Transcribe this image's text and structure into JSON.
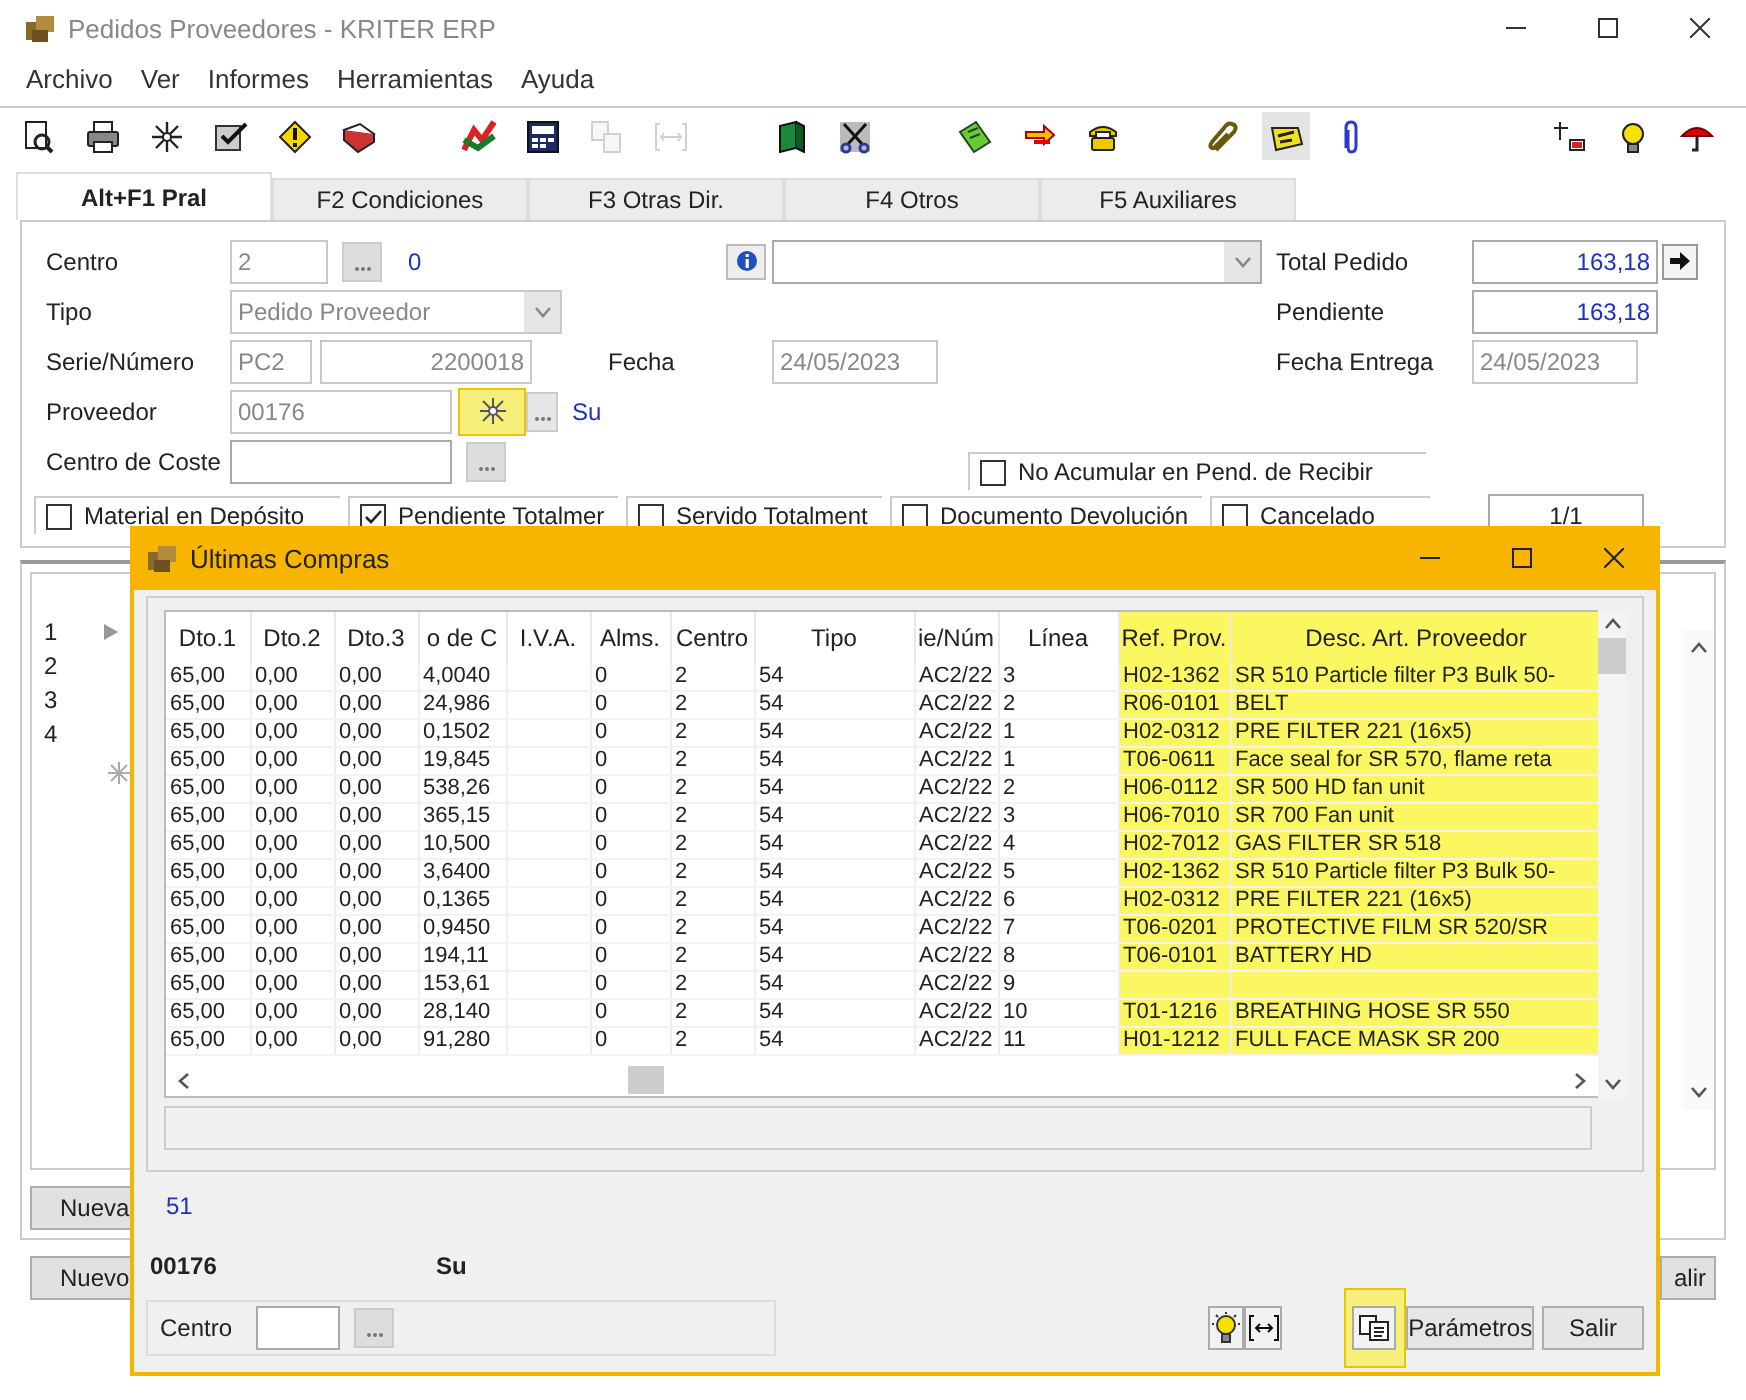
{
  "window": {
    "title": "Pedidos Proveedores - KRITER ERP"
  },
  "menu": [
    "Archivo",
    "Ver",
    "Informes",
    "Herramientas",
    "Ayuda"
  ],
  "toolbar": [
    {
      "items": [
        {
          "disabled": false,
          "pressed": false
        },
        {
          "disabled": false,
          "pressed": false
        },
        {
          "disabled": false,
          "pressed": false
        },
        {
          "disabled": false,
          "pressed": false
        },
        {
          "disabled": false,
          "pressed": false
        },
        {
          "disabled": false,
          "pressed": false
        }
      ]
    },
    {
      "items": [
        {
          "disabled": false,
          "pressed": false
        },
        {
          "disabled": false,
          "pressed": false
        },
        {
          "disabled": true,
          "pressed": false
        },
        {
          "disabled": true,
          "pressed": false
        }
      ]
    },
    {
      "items": [
        {
          "disabled": false,
          "pressed": false
        },
        {
          "disabled": false,
          "pressed": false
        }
      ]
    },
    {
      "items": [
        {
          "disabled": false,
          "pressed": false
        },
        {
          "disabled": false,
          "pressed": false
        },
        {
          "disabled": false,
          "pressed": false
        }
      ]
    },
    {
      "items": [
        {
          "disabled": false,
          "pressed": false
        },
        {
          "disabled": false,
          "pressed": true
        },
        {
          "disabled": false,
          "pressed": false
        }
      ]
    },
    {
      "items": [
        {
          "disabled": false,
          "pressed": false
        },
        {
          "disabled": false,
          "pressed": false
        },
        {
          "disabled": false,
          "pressed": false
        }
      ]
    }
  ],
  "tabs": [
    {
      "label": "Alt+F1 Pral",
      "selected": true
    },
    {
      "label": "F2 Condiciones",
      "selected": false
    },
    {
      "label": "F3 Otras Dir.",
      "selected": false
    },
    {
      "label": "F4 Otros",
      "selected": false
    },
    {
      "label": "F5 Auxiliares",
      "selected": false
    }
  ],
  "form": {
    "centro": {
      "label": "Centro",
      "value": "2",
      "note": "0",
      "disabled": true
    },
    "tipo": {
      "label": "Tipo",
      "value": "Pedido Proveedor",
      "disabled": true
    },
    "serie": {
      "label": "Serie/Número",
      "serie": "PC2",
      "numero": "2200018",
      "disabled": true
    },
    "fecha": {
      "label": "Fecha",
      "value": "24/05/2023",
      "disabled": true
    },
    "proveedor": {
      "label": "Proveedor",
      "value": "00176",
      "name": "Su",
      "disabled": true,
      "search_highlighted": true
    },
    "centro_coste": {
      "label": "Centro de Coste"
    },
    "total_pedido": {
      "label": "Total Pedido",
      "value": "163,18"
    },
    "pendiente": {
      "label": "Pendiente",
      "value": "163,18"
    },
    "fecha_entrega": {
      "label": "Fecha Entrega",
      "value": "24/05/2023",
      "disabled": true
    },
    "no_acumular": {
      "label": "No Acumular en Pend. de Recibir",
      "checked": false
    },
    "flags": [
      {
        "label": "Material en Depósito",
        "checked": false
      },
      {
        "label": "Pendiente Totalmer",
        "checked": true
      },
      {
        "label": "Servido Totalment",
        "checked": false
      },
      {
        "label": "Documento Devolución",
        "checked": false
      },
      {
        "label": "Cancelado",
        "checked": false
      }
    ],
    "page": "1/1"
  },
  "lines": {
    "row_numbers": [
      "1",
      "2",
      "3",
      "4"
    ],
    "new_line_button": "Nueva"
  },
  "bottom_buttons": [
    "Nuevo",
    "alir"
  ],
  "dialog": {
    "title": "Últimas Compras",
    "columns": [
      {
        "label": "Dto.1",
        "highlighted": false
      },
      {
        "label": "Dto.2",
        "highlighted": false
      },
      {
        "label": "Dto.3",
        "highlighted": false
      },
      {
        "label": "o de C",
        "highlighted": false
      },
      {
        "label": "I.V.A.",
        "highlighted": false
      },
      {
        "label": "Alms.",
        "highlighted": false
      },
      {
        "label": "Centro",
        "highlighted": false
      },
      {
        "label": "Tipo",
        "highlighted": false
      },
      {
        "label": "ie/Núm",
        "highlighted": false
      },
      {
        "label": "Línea",
        "highlighted": false
      },
      {
        "label": "Ref. Prov.",
        "highlighted": true
      },
      {
        "label": "Desc. Art. Proveedor",
        "highlighted": true
      }
    ],
    "rows": [
      [
        "65,00",
        "0,00",
        "0,00",
        "4,0040",
        "",
        "0",
        "2",
        "54",
        "AC2/22",
        "3",
        "H02-1362",
        "SR 510 Particle filter P3 Bulk 50-"
      ],
      [
        "65,00",
        "0,00",
        "0,00",
        "24,986",
        "",
        "0",
        "2",
        "54",
        "AC2/22",
        "2",
        "R06-0101",
        "BELT"
      ],
      [
        "65,00",
        "0,00",
        "0,00",
        "0,1502",
        "",
        "0",
        "2",
        "54",
        "AC2/22",
        "1",
        "H02-0312",
        "PRE FILTER 221 (16x5)"
      ],
      [
        "65,00",
        "0,00",
        "0,00",
        "19,845",
        "",
        "0",
        "2",
        "54",
        "AC2/22",
        "1",
        "T06-0611",
        "Face seal for SR 570, flame reta"
      ],
      [
        "65,00",
        "0,00",
        "0,00",
        "538,26",
        "",
        "0",
        "2",
        "54",
        "AC2/22",
        "2",
        "H06-0112",
        "SR 500 HD fan unit"
      ],
      [
        "65,00",
        "0,00",
        "0,00",
        "365,15",
        "",
        "0",
        "2",
        "54",
        "AC2/22",
        "3",
        "H06-7010",
        "SR 700 Fan unit"
      ],
      [
        "65,00",
        "0,00",
        "0,00",
        "10,500",
        "",
        "0",
        "2",
        "54",
        "AC2/22",
        "4",
        "H02-7012",
        "GAS FILTER SR 518"
      ],
      [
        "65,00",
        "0,00",
        "0,00",
        "3,6400",
        "",
        "0",
        "2",
        "54",
        "AC2/22",
        "5",
        "H02-1362",
        "SR 510 Particle filter P3 Bulk 50-"
      ],
      [
        "65,00",
        "0,00",
        "0,00",
        "0,1365",
        "",
        "0",
        "2",
        "54",
        "AC2/22",
        "6",
        "H02-0312",
        "PRE FILTER 221 (16x5)"
      ],
      [
        "65,00",
        "0,00",
        "0,00",
        "0,9450",
        "",
        "0",
        "2",
        "54",
        "AC2/22",
        "7",
        "T06-0201",
        "PROTECTIVE FILM SR 520/SR"
      ],
      [
        "65,00",
        "0,00",
        "0,00",
        "194,11",
        "",
        "0",
        "2",
        "54",
        "AC2/22",
        "8",
        "T06-0101",
        "BATTERY HD"
      ],
      [
        "65,00",
        "0,00",
        "0,00",
        "153,61",
        "",
        "0",
        "2",
        "54",
        "AC2/22",
        "9",
        "",
        ""
      ],
      [
        "65,00",
        "0,00",
        "0,00",
        "28,140",
        "",
        "0",
        "2",
        "54",
        "AC2/22",
        "10",
        "T01-1216",
        "BREATHING HOSE SR 550"
      ],
      [
        "65,00",
        "0,00",
        "0,00",
        "91,280",
        "",
        "0",
        "2",
        "54",
        "AC2/22",
        "11",
        "H01-1212",
        "FULL FACE MASK SR 200"
      ]
    ],
    "count": "51",
    "supplier_code": "00176",
    "supplier_name": "Su",
    "centro": {
      "label": "Centro"
    },
    "copy_highlighted": true,
    "buttons": [
      "Parámetros",
      "Salir"
    ]
  }
}
